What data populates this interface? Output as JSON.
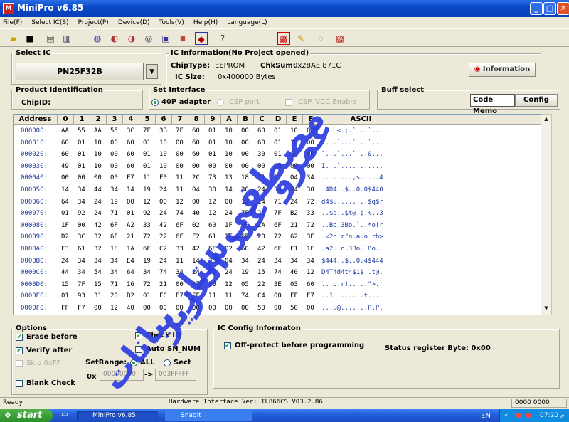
{
  "window": {
    "title": "MiniPro v6.85"
  },
  "menu": [
    "File(F)",
    "Select IC(S)",
    "Project(P)",
    "Device(D)",
    "Tools(V)",
    "Help(H)",
    "Language(L)"
  ],
  "select_ic": {
    "label": "Select IC",
    "value": "PN25F32B"
  },
  "ic_info": {
    "label": "IC Information(No Project opened)",
    "chiptype_label": "ChipType:",
    "chiptype": "EEPROM",
    "chksum_label": "ChkSum:",
    "chksum": "0x28AE 871C",
    "icsize_label": "IC Size:",
    "icsize": "0x400000 Bytes",
    "info_button": "Information"
  },
  "product": {
    "label": "Product Identification",
    "chipid_label": "ChipID:"
  },
  "interface": {
    "label": "Set Interface",
    "opt1": "40P adapter",
    "opt2": "ICSP port",
    "opt3": "ICSP_VCC Enable"
  },
  "buffer": {
    "label": "Buff select",
    "code_memo": "Code Memo",
    "config": "Config"
  },
  "grid": {
    "headers": [
      "Address",
      "0",
      "1",
      "2",
      "3",
      "4",
      "5",
      "6",
      "7",
      "8",
      "9",
      "A",
      "B",
      "C",
      "D",
      "E",
      "F",
      "ASCII"
    ],
    "rows": [
      {
        "addr": "000000:",
        "b": [
          "AA",
          "55",
          "AA",
          "55",
          "3C",
          "7F",
          "3B",
          "7F",
          "60",
          "01",
          "10",
          "00",
          "60",
          "01",
          "10",
          "00"
        ],
        "a": ".U.U<.;.`...`..."
      },
      {
        "addr": "000010:",
        "b": [
          "60",
          "01",
          "10",
          "00",
          "60",
          "01",
          "10",
          "00",
          "60",
          "01",
          "10",
          "00",
          "60",
          "01",
          "10",
          "00"
        ],
        "a": "`...`...`...`..."
      },
      {
        "addr": "000020:",
        "b": [
          "60",
          "01",
          "10",
          "00",
          "60",
          "01",
          "10",
          "00",
          "60",
          "01",
          "10",
          "00",
          "30",
          "01",
          "10",
          "00"
        ],
        "a": "`...`...`...0..."
      },
      {
        "addr": "000030:",
        "b": [
          "49",
          "01",
          "10",
          "00",
          "60",
          "01",
          "10",
          "00",
          "00",
          "00",
          "00",
          "00",
          "00",
          "00",
          "00",
          "00"
        ],
        "a": "I...`..........."
      },
      {
        "addr": "000040:",
        "b": [
          "00",
          "00",
          "00",
          "00",
          "F7",
          "11",
          "F0",
          "11",
          "2C",
          "73",
          "13",
          "18",
          "11",
          "11",
          "04",
          "34"
        ],
        "a": "........,s.....4"
      },
      {
        "addr": "000050:",
        "b": [
          "14",
          "34",
          "44",
          "34",
          "14",
          "19",
          "24",
          "11",
          "04",
          "30",
          "14",
          "30",
          "24",
          "34",
          "34",
          "30"
        ],
        "a": ".4D4..$..0.0$440"
      },
      {
        "addr": "000060:",
        "b": [
          "64",
          "34",
          "24",
          "19",
          "00",
          "12",
          "00",
          "12",
          "00",
          "12",
          "00",
          "12",
          "24",
          "71",
          "24",
          "72"
        ],
        "a": "d4$.........$q$r"
      },
      {
        "addr": "000070:",
        "b": [
          "01",
          "92",
          "24",
          "71",
          "01",
          "92",
          "24",
          "74",
          "40",
          "12",
          "24",
          "7F",
          "25",
          "7F",
          "B2",
          "33"
        ],
        "a": "..$q..$t@.$.%..3"
      },
      {
        "addr": "000080:",
        "b": [
          "1F",
          "00",
          "42",
          "6F",
          "A2",
          "33",
          "42",
          "6F",
          "02",
          "60",
          "1F",
          "00",
          "2A",
          "6F",
          "21",
          "72"
        ],
        "a": "..Bo.3Bo.`..*o!r"
      },
      {
        "addr": "000090:",
        "b": [
          "D2",
          "3C",
          "32",
          "6F",
          "21",
          "72",
          "22",
          "6F",
          "F2",
          "61",
          "1F",
          "6F",
          "20",
          "72",
          "62",
          "3E"
        ],
        "a": ".<2o!r\"o.a.o rb>"
      },
      {
        "addr": "0000A0:",
        "b": [
          "F3",
          "61",
          "32",
          "1E",
          "1A",
          "6F",
          "C2",
          "33",
          "42",
          "6F",
          "02",
          "60",
          "42",
          "6F",
          "F1",
          "1E"
        ],
        "a": ".a2..o.3Bo.`Bo.."
      },
      {
        "addr": "0000B0:",
        "b": [
          "24",
          "34",
          "34",
          "34",
          "E4",
          "19",
          "24",
          "11",
          "14",
          "30",
          "04",
          "34",
          "24",
          "34",
          "34",
          "34"
        ],
        "a": "$444..$..0.4$444"
      },
      {
        "addr": "0000C0:",
        "b": [
          "44",
          "34",
          "54",
          "34",
          "64",
          "34",
          "74",
          "34",
          "24",
          "31",
          "24",
          "19",
          "15",
          "74",
          "40",
          "12"
        ],
        "a": "D4T4d4t4$1$..t@."
      },
      {
        "addr": "0000D0:",
        "b": [
          "15",
          "7F",
          "15",
          "71",
          "16",
          "72",
          "21",
          "00",
          "07",
          "E0",
          "12",
          "05",
          "22",
          "3E",
          "03",
          "60"
        ],
        "a": "...q.r!.....\">.`"
      },
      {
        "addr": "0000E0:",
        "b": [
          "01",
          "93",
          "31",
          "20",
          "B2",
          "01",
          "FC",
          "E7",
          "FF",
          "11",
          "11",
          "74",
          "C4",
          "00",
          "FF",
          "F7"
        ],
        "a": "..1 .......t...."
      },
      {
        "addr": "0000F0:",
        "b": [
          "FF",
          "F7",
          "00",
          "12",
          "40",
          "00",
          "00",
          "00",
          "00",
          "00",
          "00",
          "00",
          "50",
          "00",
          "50",
          "00"
        ],
        "a": "....@.......P.P."
      }
    ]
  },
  "options": {
    "label": "Options",
    "erase": "Erase before",
    "verify": "Verify after",
    "skip": "Skip 0xFF",
    "blank": "Blank Check",
    "check_id": "Check ID",
    "auto_sn": "Auto SN_NUM",
    "setrange": "SetRange:",
    "all": "ALL",
    "sect": "Sect",
    "ox": "0x",
    "range_from": "00000000",
    "arrow": "->",
    "range_to": "003FFFFF"
  },
  "config": {
    "label": "IC Config Informaton",
    "offprotect": "Off-protect before programming",
    "status_reg": "Status register Byte: 0x00"
  },
  "hardware": "Hardware Interface Ver: TL866CS V03.2.86",
  "status": {
    "ready": "Ready",
    "right": "0000 0000"
  },
  "taskbar": {
    "start": "start",
    "task1": "MiniPro v6.85",
    "task2": "SnagIt",
    "lang": "EN",
    "time": "07:20 م"
  },
  "watermark": {
    "line1": "مصطفى",
    "line2": "عمرو عبد العزيز",
    "line3": "ستار بيانات"
  }
}
